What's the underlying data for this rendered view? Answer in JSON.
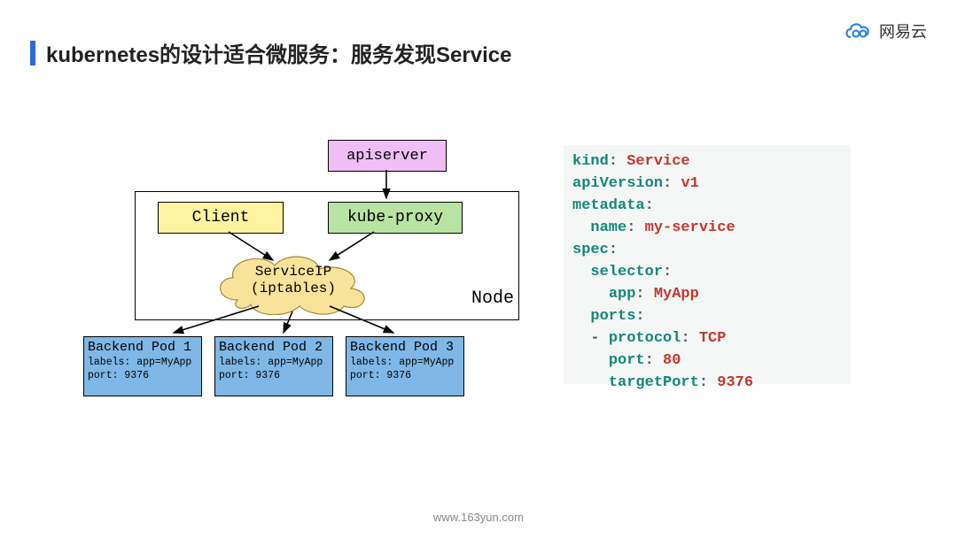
{
  "title": "kubernetes的设计适合微服务：服务发现Service",
  "logo": "网易云",
  "footer": "www.163yun.com",
  "diagram": {
    "apiserver": "apiserver",
    "client": "Client",
    "kubeproxy": "kube-proxy",
    "node_label": "Node",
    "service_ip_l1": "ServiceIP",
    "service_ip_l2": "(iptables)",
    "pods": [
      {
        "title": "Backend Pod 1",
        "labels": "labels: app=MyApp",
        "port": "port: 9376"
      },
      {
        "title": "Backend Pod 2",
        "labels": "labels: app=MyApp",
        "port": "port: 9376"
      },
      {
        "title": "Backend Pod 3",
        "labels": "labels: app=MyApp",
        "port": "port: 9376"
      }
    ]
  },
  "yaml": {
    "k_kind": "kind",
    "v_kind": "Service",
    "k_apiver": "apiVersion",
    "v_apiver": "v1",
    "k_meta": "metadata",
    "k_name": "name",
    "v_name": "my-service",
    "k_spec": "spec",
    "k_selector": "selector",
    "k_app": "app",
    "v_app": "MyApp",
    "k_ports": "ports",
    "k_proto": "protocol",
    "v_proto": "TCP",
    "k_port": "port",
    "v_port": "80",
    "k_tport": "targetPort",
    "v_tport": "9376",
    "colon": ":",
    "dash": "- "
  }
}
